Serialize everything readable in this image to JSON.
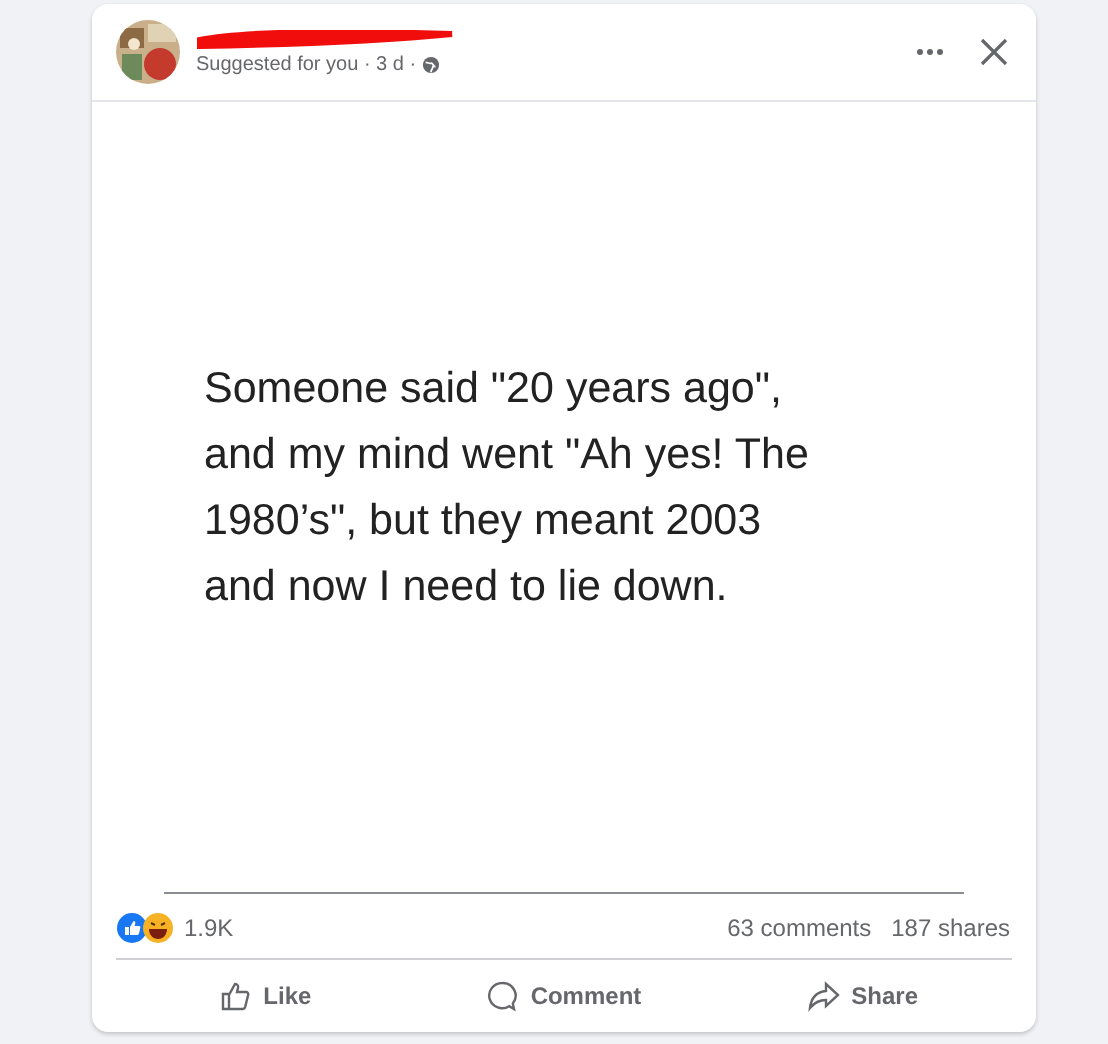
{
  "post": {
    "author_redacted": true,
    "meta": "Suggested for you · 3 d ·",
    "image_text_lines": [
      "Someone said \"20 years ago\",",
      "and my mind went \"Ah yes! The",
      "1980’s\", but they meant 2003",
      "and now I need to lie down."
    ],
    "reactions_count": "1.9K",
    "comments": "63 comments",
    "shares": "187 shares",
    "actions": [
      {
        "kind": "like",
        "label": "Like"
      },
      {
        "kind": "comment",
        "label": "Comment"
      },
      {
        "kind": "share",
        "label": "Share"
      }
    ]
  }
}
